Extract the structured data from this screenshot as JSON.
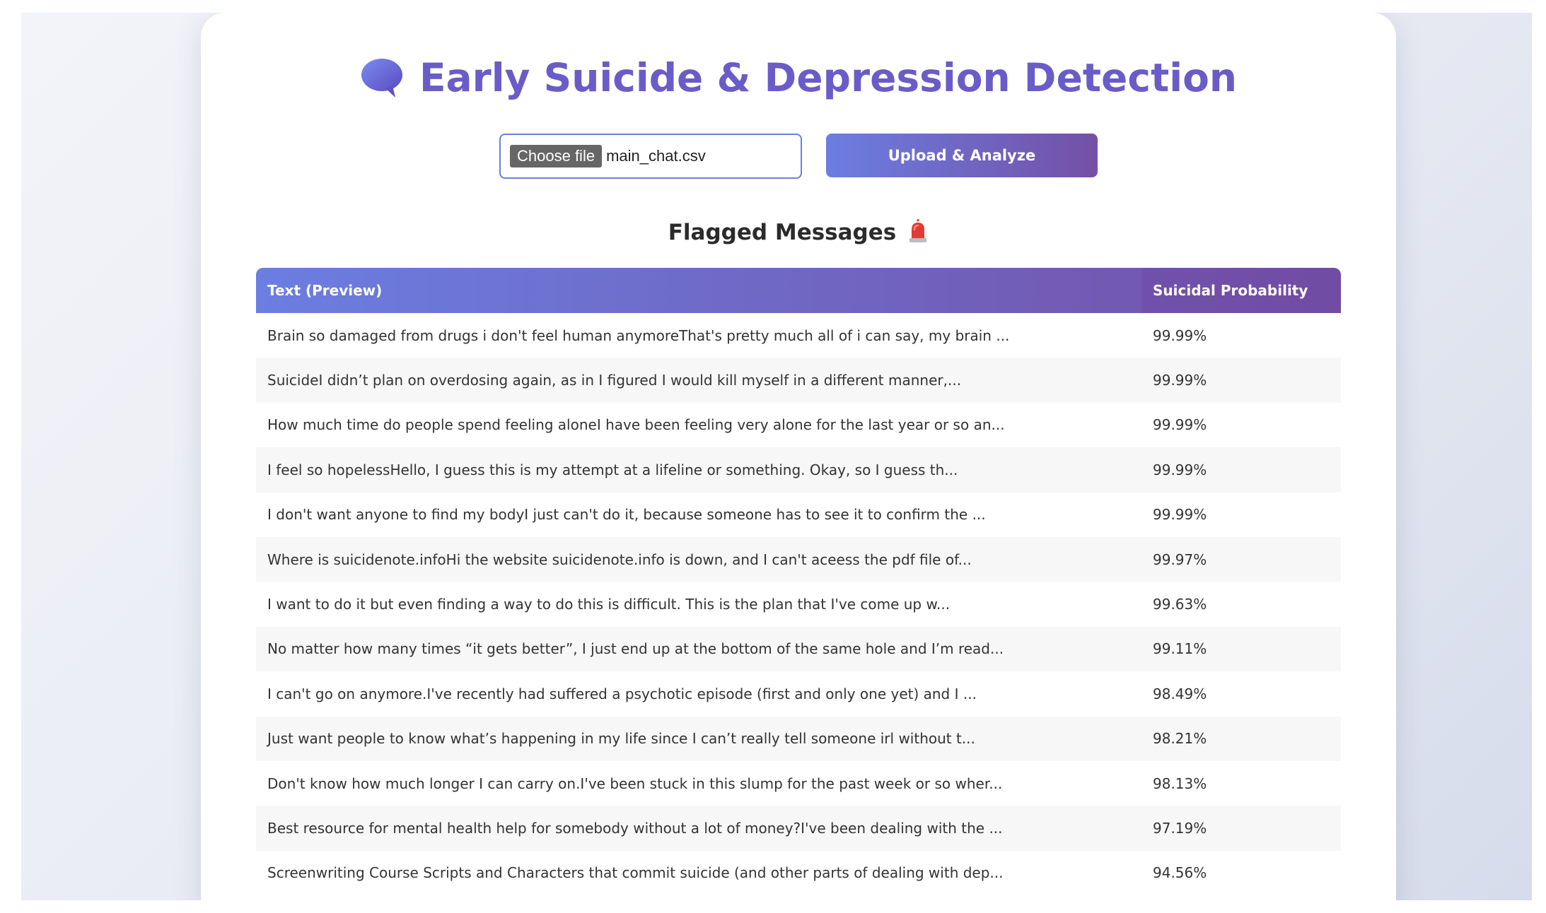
{
  "header": {
    "icon": "speech-bubble-icon",
    "title": "Early Suicide & Depression Detection"
  },
  "upload": {
    "choose_file_label": "Choose file",
    "file_name": "main_chat.csv",
    "submit_label": "Upload & Analyze"
  },
  "results": {
    "section_title": "Flagged Messages",
    "section_icon": "siren-icon",
    "columns": {
      "text": "Text (Preview)",
      "probability": "Suicidal Probability"
    },
    "rows": [
      {
        "text": "Brain so damaged from drugs i don't feel human anymoreThat's pretty much all of i can say, my brain ...",
        "probability": "99.99%"
      },
      {
        "text": "SuicideI didn’t plan on overdosing again, as in I figured I would kill myself in a different manner,...",
        "probability": "99.99%"
      },
      {
        "text": "How much time do people spend feeling aloneI have been feeling very alone for the last year or so an...",
        "probability": "99.99%"
      },
      {
        "text": "I feel so hopelessHello, I guess this is my attempt at a lifeline or something. Okay, so I guess th...",
        "probability": "99.99%"
      },
      {
        "text": "I don't want anyone to find my bodyI just can't do it, because someone has to see it to confirm the ...",
        "probability": "99.99%"
      },
      {
        "text": "Where is suicidenote.infoHi the website suicidenote.info is down, and I can't aceess the pdf file of...",
        "probability": "99.97%"
      },
      {
        "text": "I want to do it but even finding a way to do this is difficult. This is the plan that I've come up w...",
        "probability": "99.63%"
      },
      {
        "text": "No matter how many times “it gets better”, I just end up at the bottom of the same hole and I’m read...",
        "probability": "99.11%"
      },
      {
        "text": "I can't go on anymore.I've recently had suffered a psychotic episode (first and only one yet) and I ...",
        "probability": "98.49%"
      },
      {
        "text": "Just want people to know what’s happening in my life since I can’t really tell someone irl without t...",
        "probability": "98.21%"
      },
      {
        "text": "Don't know how much longer I can carry on.I've been stuck in this slump for the past week or so wher...",
        "probability": "98.13%"
      },
      {
        "text": "Best resource for mental health help for somebody without a lot of money?I've been dealing with the ...",
        "probability": "97.19%"
      },
      {
        "text": "Screenwriting Course Scripts and Characters that commit suicide (and other parts of dealing with dep...",
        "probability": "94.56%"
      }
    ]
  },
  "colors": {
    "accent_start": "#6b7ee1",
    "accent_end": "#7450a6",
    "title": "#6a5cc8"
  }
}
